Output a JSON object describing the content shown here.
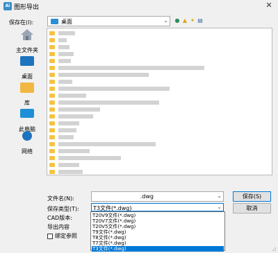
{
  "window": {
    "title": "图形导出",
    "app_icon_text": "Ai"
  },
  "toolbar": {
    "save_in_label": "保存在(I):",
    "save_in_value": "桌面"
  },
  "sidebar": {
    "items": [
      {
        "label": "主文件夹",
        "icon": "home-icon"
      },
      {
        "label": "桌面",
        "icon": "desktop-icon"
      },
      {
        "label": "库",
        "icon": "library-icon"
      },
      {
        "label": "此电脑",
        "icon": "computer-icon"
      },
      {
        "label": "网络",
        "icon": "network-icon"
      }
    ]
  },
  "form": {
    "filename_label": "文件名(N):",
    "filename_value": ".dwg",
    "filetype_label": "保存类型(T):",
    "filetype_value": "T3文件(*.dwg)",
    "cad_version_label": "CAD版本:",
    "export_content_label": "导出内容",
    "bind_xref_label": "绑定参照"
  },
  "dropdown": {
    "options": [
      "T20V9文件(*.dwg)",
      "T20V7文件(*.dwg)",
      "T20V5文件(*.dwg)",
      "T9文件(*.dwg)",
      "T8文件(*.dwg)",
      "T7文件(*.dwg)",
      "T3文件(*.dwg)"
    ],
    "selected_index": 6
  },
  "buttons": {
    "save": "保存(S)",
    "cancel": "取消"
  },
  "colors": {
    "accent": "#0078d7",
    "folder": "#f5c342"
  }
}
